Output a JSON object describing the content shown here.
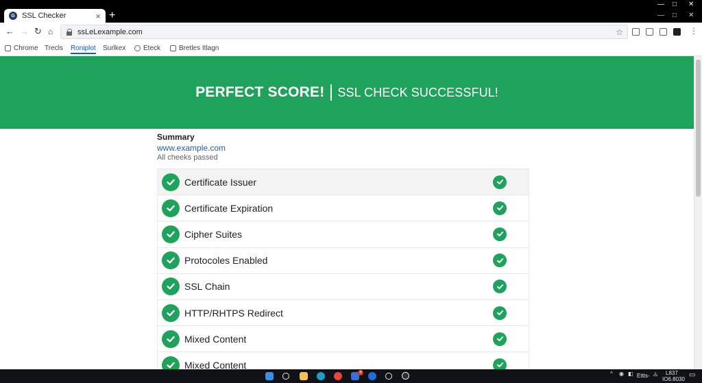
{
  "browser": {
    "tab_title": "SSL Checker",
    "tab_close": "×",
    "new_tab": "+",
    "url": "ssLeLexample.com",
    "bookmarks": [
      "Chrome",
      "Trecls",
      "Roniplot",
      "Surlkex",
      "Eteck",
      "Bretles Itlagn"
    ]
  },
  "banner": {
    "title": "PERFECT SCORE!",
    "subtitle": "SSL CHECK SUCCESSFUL!"
  },
  "summary": {
    "heading": "Summary",
    "domain": "www.example.com",
    "status": "All cheeks passed"
  },
  "checks": [
    {
      "label": "Certificate Issuer"
    },
    {
      "label": "Certificate Expiration"
    },
    {
      "label": "Cipher Suites"
    },
    {
      "label": "Protocoles Enabled"
    },
    {
      "label": "SSL Chain"
    },
    {
      "label": "HTTP/RHTPS Redirect"
    },
    {
      "label": "Mixed Content"
    },
    {
      "label": "Mixed Content"
    }
  ],
  "colors": {
    "success": "#1fa25b",
    "link": "#2a5aa6",
    "active_bookmark": "#1a56c4"
  },
  "taskbar": {
    "badge_count": "8",
    "tray_label": "Ettts-",
    "time": "L837",
    "date": "IO6.8030"
  }
}
